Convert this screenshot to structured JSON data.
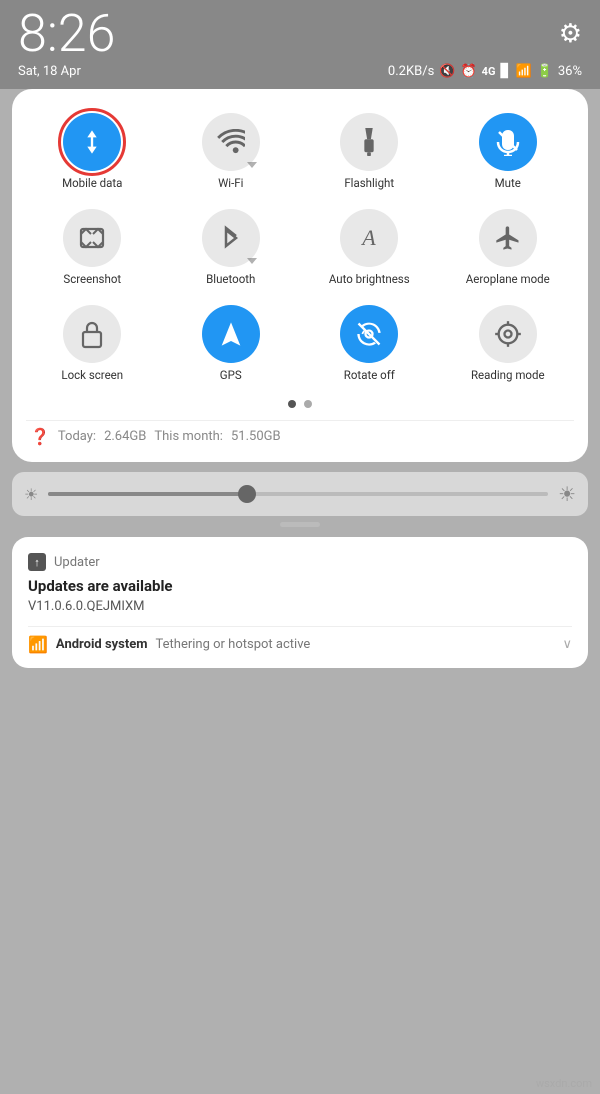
{
  "status_bar": {
    "time": "8:26",
    "date": "Sat, 18 Apr",
    "network_speed": "0.2KB/s",
    "battery": "36%",
    "gear_label": "⚙"
  },
  "tiles": [
    {
      "id": "mobile-data",
      "label": "Mobile data",
      "icon": "data",
      "active": true,
      "selected": true
    },
    {
      "id": "wifi",
      "label": "Wi-Fi",
      "icon": "wifi",
      "active": false,
      "arrow": true
    },
    {
      "id": "flashlight",
      "label": "Flashlight",
      "icon": "flashlight",
      "active": false
    },
    {
      "id": "mute",
      "label": "Mute",
      "icon": "mute",
      "active": true
    },
    {
      "id": "screenshot",
      "label": "Screenshot",
      "icon": "screenshot",
      "active": false
    },
    {
      "id": "bluetooth",
      "label": "Bluetooth",
      "icon": "bluetooth",
      "active": false,
      "arrow": true
    },
    {
      "id": "auto-brightness",
      "label": "Auto brightness",
      "icon": "brightness",
      "active": false
    },
    {
      "id": "aeroplane",
      "label": "Aeroplane mode",
      "icon": "aeroplane",
      "active": false
    },
    {
      "id": "lock-screen",
      "label": "Lock screen",
      "icon": "lock",
      "active": false
    },
    {
      "id": "gps",
      "label": "GPS",
      "icon": "gps",
      "active": true
    },
    {
      "id": "rotate-off",
      "label": "Rotate off",
      "icon": "rotate",
      "active": true
    },
    {
      "id": "reading-mode",
      "label": "Reading mode",
      "icon": "reading",
      "active": false
    }
  ],
  "pagination": {
    "current": 0,
    "total": 2
  },
  "data_usage": {
    "today_label": "Today:",
    "today_value": "2.64GB",
    "month_label": "This month:",
    "month_value": "51.50GB"
  },
  "brightness": {
    "level": 40
  },
  "notifications": [
    {
      "app": "Updater",
      "app_icon": "↑",
      "title": "Updates are available",
      "body": "V11.0.6.0.QEJMIXM"
    }
  ],
  "android_system_notif": {
    "icon": "wifi",
    "app": "Android system",
    "desc": "Tethering or hotspot active",
    "chevron": "˅"
  },
  "watermark": "wsxdn.com"
}
